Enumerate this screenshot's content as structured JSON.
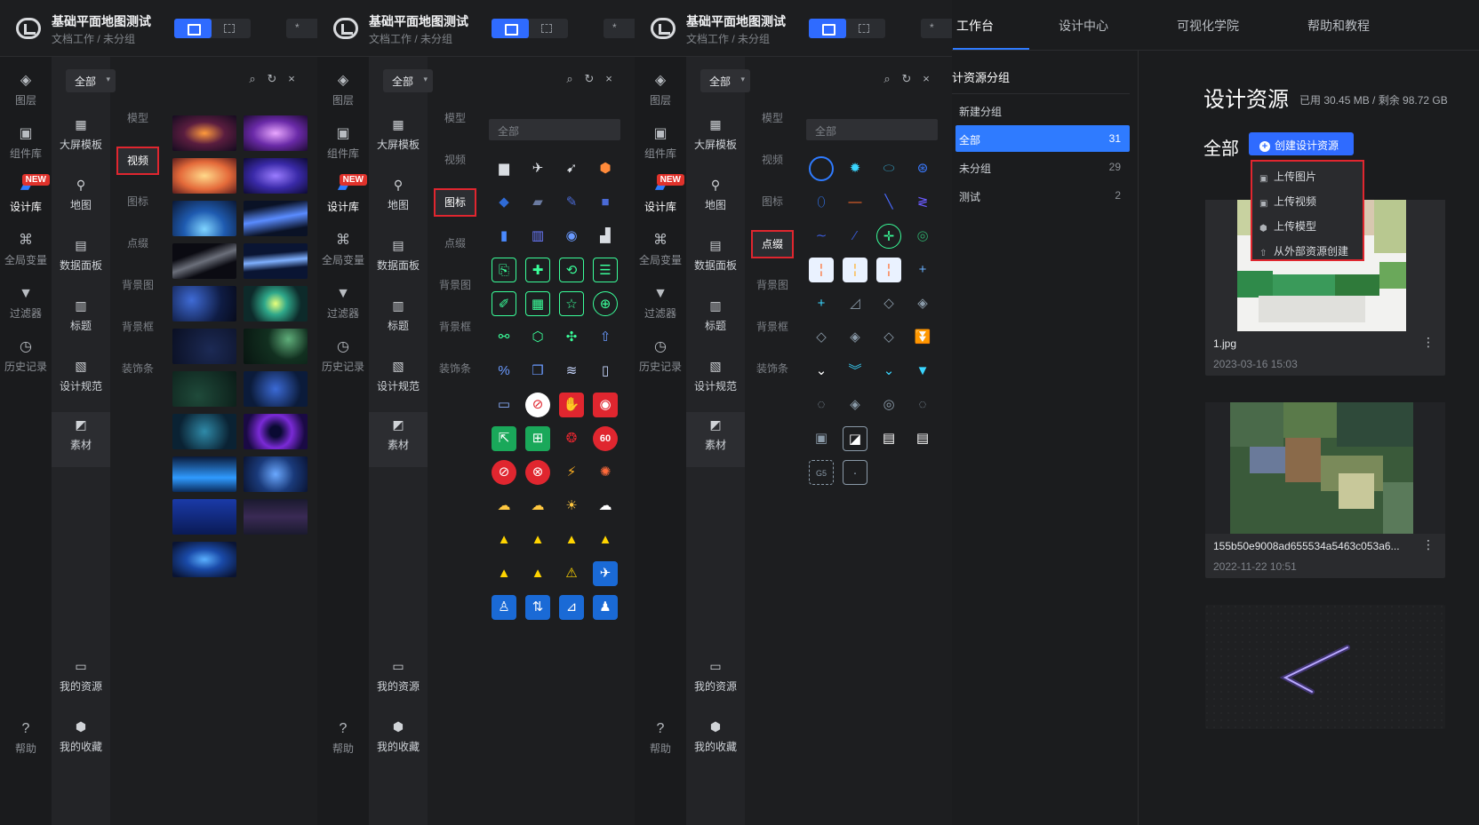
{
  "doc": {
    "title": "基础平面地图测试",
    "subtitle": "文档工作 / 未分组",
    "extra_chip": "*"
  },
  "left_nav": [
    {
      "label": "图层",
      "icon": "layers-icon"
    },
    {
      "label": "组件库",
      "icon": "image-icon"
    },
    {
      "label": "设计库",
      "icon": "design-library-icon",
      "badge": "NEW"
    },
    {
      "label": "全局变量",
      "icon": "variable-icon"
    },
    {
      "label": "过滤器",
      "icon": "filter-icon"
    },
    {
      "label": "历史记录",
      "icon": "history-icon"
    },
    {
      "label": "帮助",
      "icon": "help-icon"
    }
  ],
  "categories": [
    {
      "label": "大屏模板",
      "icon": "template-icon"
    },
    {
      "label": "地图",
      "icon": "map-pin-icon"
    },
    {
      "label": "数据面板",
      "icon": "panel-icon"
    },
    {
      "label": "标题",
      "icon": "title-icon"
    },
    {
      "label": "设计规范",
      "icon": "spec-icon"
    },
    {
      "label": "素材",
      "icon": "material-icon"
    },
    {
      "label": "我的资源",
      "icon": "folder-icon"
    },
    {
      "label": "我的收藏",
      "icon": "favorite-icon"
    }
  ],
  "types": [
    "模型",
    "视频",
    "图标",
    "点缀",
    "背景图",
    "背景框",
    "装饰条"
  ],
  "selected_types": [
    "视频",
    "图标",
    "点缀"
  ],
  "filter_all": "全部",
  "dropdown_placeholder": "全部",
  "right": {
    "tabs": [
      "工作台",
      "设计中心",
      "可视化学院",
      "帮助和教程"
    ],
    "group_title": "计资源分组",
    "new_group": "新建分组",
    "groups": [
      {
        "name": "全部",
        "count": "31"
      },
      {
        "name": "未分组",
        "count": "29"
      },
      {
        "name": "测试",
        "count": "2"
      }
    ],
    "res_title": "设计资源",
    "usage": "已用 30.45 MB / 剩余 98.72 GB",
    "all_label": "全部",
    "create_btn": "创建设计资源",
    "menu": [
      "上传图片",
      "上传视频",
      "上传模型",
      "从外部资源创建"
    ],
    "cards": [
      {
        "name": "1.jpg",
        "date": "2023-03-16 15:03"
      },
      {
        "name": "155b50e9008ad655534a5463c053a6...",
        "date": "2022-11-22 10:51"
      }
    ]
  },
  "colors": {
    "accent": "#2f7bff",
    "highlight": "#e0262f",
    "bg": "#1d1e20"
  }
}
